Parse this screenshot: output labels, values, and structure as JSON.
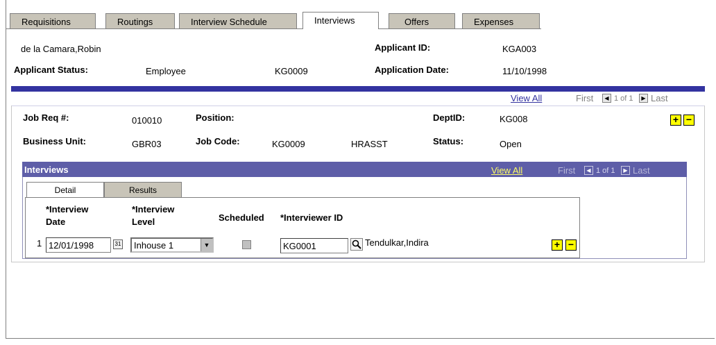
{
  "tabs": [
    {
      "label": "Requisitions",
      "active": false
    },
    {
      "label": "Routings",
      "active": false
    },
    {
      "label": "Interview Schedule",
      "active": false
    },
    {
      "label": "Interviews",
      "active": true
    },
    {
      "label": "Offers",
      "active": false
    },
    {
      "label": "Expenses",
      "active": false
    }
  ],
  "applicant": {
    "name": "de la Camara,Robin",
    "id_label": "Applicant ID:",
    "id_value": "KGA003",
    "status_label": "Applicant Status:",
    "status_value": "Employee",
    "status_code": "KG0009",
    "app_date_label": "Application Date:",
    "app_date_value": "11/10/1998"
  },
  "nav": {
    "view_all": "View All",
    "first": "First",
    "count": "1 of 1",
    "last": "Last"
  },
  "job": {
    "req_label": "Job Req #:",
    "req_value": "010010",
    "position_label": "Position:",
    "dept_label": "DeptID:",
    "dept_value": "KG008",
    "bu_label": "Business Unit:",
    "bu_value": "GBR03",
    "jobcode_label": "Job Code:",
    "jobcode_value": "KG0009",
    "jobcode_desc": "HRASST",
    "status_label": "Status:",
    "status_value": "Open"
  },
  "interviews": {
    "title": "Interviews",
    "view_all": "View All",
    "first": "First",
    "count": "1 of 1",
    "last": "Last",
    "subtabs": [
      "Detail",
      "Results"
    ],
    "headers": {
      "date_1": "*Interview",
      "date_2": "Date",
      "level_1": "*Interview",
      "level_2": "Level",
      "scheduled": "Scheduled",
      "interviewer": "*Interviewer ID"
    },
    "rows": [
      {
        "num": "1",
        "date": "12/01/1998",
        "level": "Inhouse 1",
        "scheduled": false,
        "interviewer_id": "KG0001",
        "interviewer_name": "Tendulkar,Indira"
      }
    ]
  },
  "icons": {
    "add": "+",
    "remove": "−",
    "calendar": "31",
    "lookup": "magnifier-icon",
    "dropdown": "▼",
    "prev": "◀",
    "next": "▶"
  },
  "colors": {
    "bar_blue": "#3333a0",
    "interviews_bar": "#5e5ea8",
    "button_yellow": "#ffff00"
  }
}
